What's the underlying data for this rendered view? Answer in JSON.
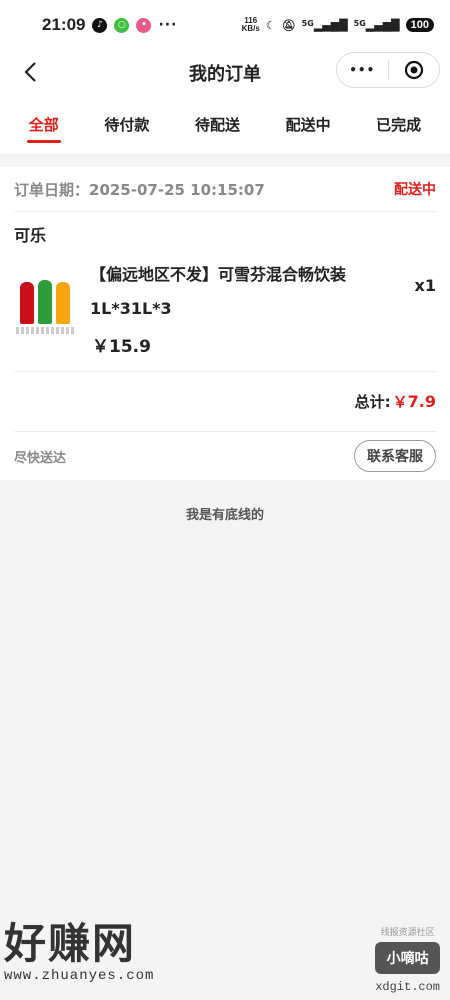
{
  "status_bar": {
    "time": "21:09",
    "more": "···",
    "net_speed_value": "116",
    "net_speed_unit": "KB/s",
    "signal1": "5G",
    "signal2": "5G",
    "battery": "100"
  },
  "nav": {
    "title": "我的订单",
    "capsule_more": "•••"
  },
  "tabs": [
    {
      "label": "全部",
      "active": true
    },
    {
      "label": "待付款"
    },
    {
      "label": "待配送"
    },
    {
      "label": "配送中"
    },
    {
      "label": "已完成"
    }
  ],
  "order": {
    "date_label": "订单日期：2025-07-25  10:15:07",
    "status": "配送中",
    "shop": "可乐",
    "product": {
      "name_line1": "【偏远地区不发】可雪芬混合畅饮装",
      "name_line2": "1L*31L*3",
      "price": "￥15.9",
      "qty": "x1"
    },
    "total_label": "总计:",
    "total_currency": "￥",
    "total_value": "7.9",
    "hint": "尽快送达",
    "service_button": "联系客服"
  },
  "footer_text": "我是有底线的",
  "watermarks": {
    "left_big": "好赚网",
    "left_url": "www.zhuanyes.com",
    "right_small": "线报资源社区",
    "right_badge": "小嘀咕",
    "right_url": "xdgit.com"
  },
  "colors": {
    "accent": "#e0201b"
  }
}
